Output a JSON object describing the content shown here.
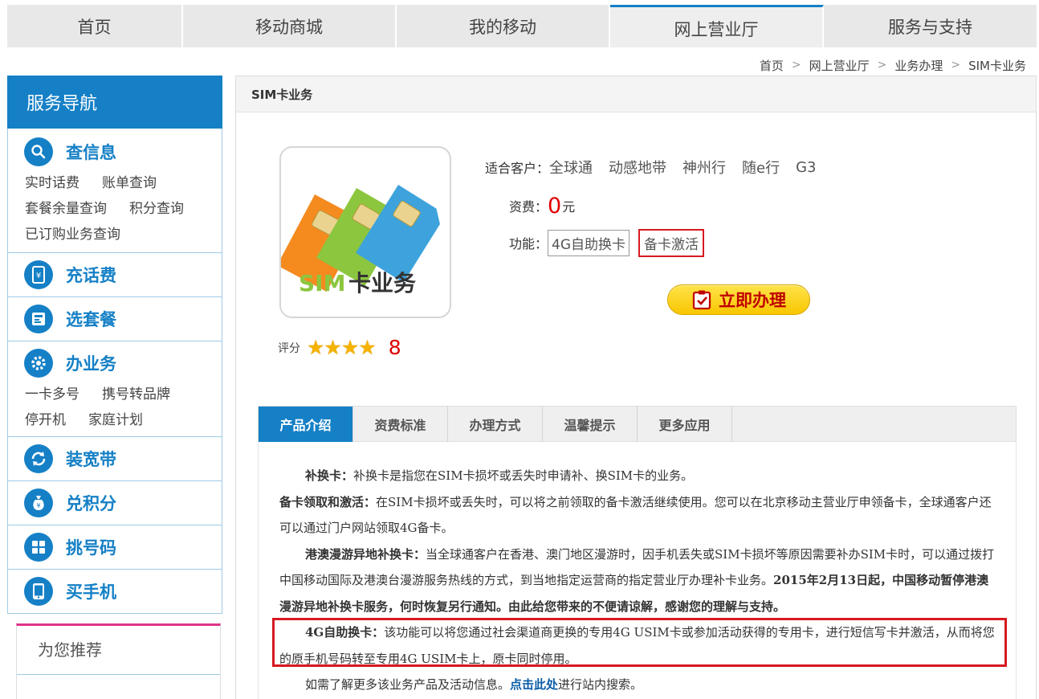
{
  "topnav": {
    "tabs": [
      {
        "label": "首页"
      },
      {
        "label": "移动商城"
      },
      {
        "label": "我的移动"
      },
      {
        "label": "网上营业厅"
      },
      {
        "label": "服务与支持"
      }
    ],
    "active_index": 3
  },
  "breadcrumb": {
    "items": [
      "首页",
      "网上营业厅",
      "业务办理",
      "SIM卡业务"
    ],
    "separator": ">"
  },
  "sidebar": {
    "title": "服务导航",
    "sections": [
      {
        "title": "查信息",
        "icon": "search-icon",
        "links": [
          "实时话费",
          "账单查询",
          "套餐余量查询",
          "积分查询",
          "已订购业务查询"
        ]
      },
      {
        "title": "充话费",
        "icon": "yen-phone-icon",
        "links": []
      },
      {
        "title": "选套餐",
        "icon": "package-icon",
        "links": []
      },
      {
        "title": "办业务",
        "icon": "gear-icon",
        "links": [
          "一卡多号",
          "携号转品牌",
          "停开机",
          "家庭计划"
        ]
      },
      {
        "title": "装宽带",
        "icon": "refresh-icon",
        "links": []
      },
      {
        "title": "兑积分",
        "icon": "money-bag-icon",
        "links": []
      },
      {
        "title": "挑号码",
        "icon": "grid-icon",
        "links": []
      },
      {
        "title": "买手机",
        "icon": "phone-icon",
        "links": []
      }
    ],
    "recommend_title": "为您推荐"
  },
  "main": {
    "header": "SIM卡业务",
    "product_image_text": {
      "sim": "SIM",
      "rest": "卡业务"
    },
    "rating": {
      "label": "评分",
      "stars": 4,
      "score": "8"
    },
    "customers_label": "适合客户：",
    "customers": [
      "全球通",
      "动感地带",
      "神州行",
      "随e行",
      "G3"
    ],
    "fee_label": "资费：",
    "fee_value": "0",
    "fee_unit": "元",
    "function_label": "功能：",
    "functions": [
      "4G自助换卡",
      "备卡激活"
    ],
    "apply_button": "立即办理",
    "tabs": [
      "产品介绍",
      "资费标准",
      "办理方式",
      "温馨提示",
      "更多应用"
    ],
    "active_tab": 0,
    "paragraphs": {
      "p1_bold": "补换卡：",
      "p1_text": "补换卡是指您在SIM卡损坏或丢失时申请补、换SIM卡的业务。",
      "p2_bold": "备卡领取和激活：",
      "p2_text": "在SIM卡损坏或丢失时，可以将之前领取的备卡激活继续使用。您可以在北京移动主营业厅申领备卡，全球通客户还可以通过门户网站领取4G备卡。",
      "p3_bold": "港澳漫游异地补换卡：",
      "p3_text": "当全球通客户在香港、澳门地区漫游时，因手机丢失或SIM卡损坏等原因需要补办SIM卡时，可以通过拨打中国移动国际及港澳台漫游服务热线的方式，到当地指定运营商的指定营业厅办理补卡业务。",
      "p3_bold2": "2015年2月13日起，中国移动暂停港澳漫游异地补换卡服务，何时恢复另行通知。由此给您带来的不便请谅解，感谢您的理解与支持。",
      "p4_bold": "4G自助换卡：",
      "p4_text": "该功能可以将您通过社会渠道商更换的专用4G USIM卡或参加活动获得的专用卡，进行短信写卡并激活，从而将您的原手机号码转至专用4G USIM卡上，原卡同时停用。",
      "p5_text_a": "如需了解更多该业务产品及活动信息。",
      "p5_link": "点击此处",
      "p5_text_b": "进行站内搜索。"
    }
  }
}
